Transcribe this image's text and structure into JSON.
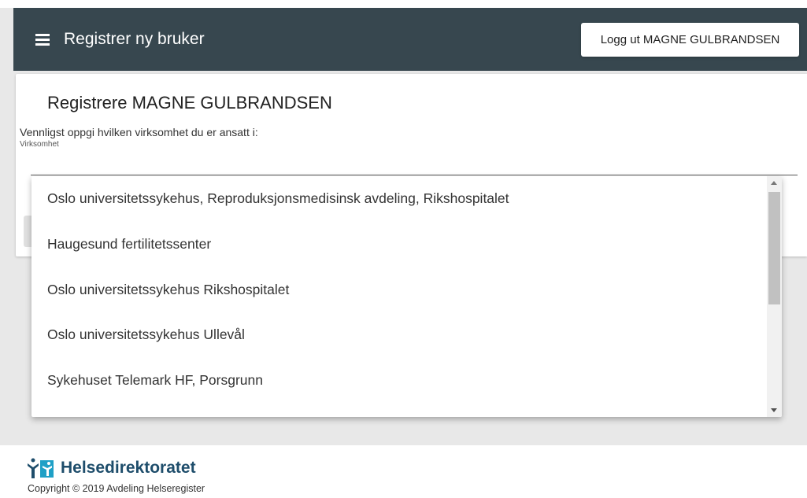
{
  "app_bar": {
    "title": "Registrer ny bruker",
    "logout_label": "Logg ut MAGNE GULBRANDSEN",
    "background_color": "#37474f"
  },
  "card": {
    "title": "Registrere MAGNE GULBRANDSEN",
    "intro": "Vennligst oppgi hvilken virksomhet du er ansatt i:",
    "field_label": "Virksomhet"
  },
  "dropdown": {
    "options": [
      "Oslo universitetssykehus, Reproduksjonsmedisinsk avdeling, Rikshospitalet",
      "Haugesund fertilitetssenter",
      "Oslo universitetssykehus Rikshospitalet",
      "Oslo universitetssykehus Ullevål",
      "Sykehuset Telemark HF, Porsgrunn"
    ]
  },
  "footer": {
    "logo_text": "Helsedirektoratet",
    "copyright": "Copyright © 2019 Avdeling Helseregister"
  },
  "icons": {
    "menu": "hamburger-menu-icon",
    "logo": "helsedirektoratet-logo-icon"
  }
}
